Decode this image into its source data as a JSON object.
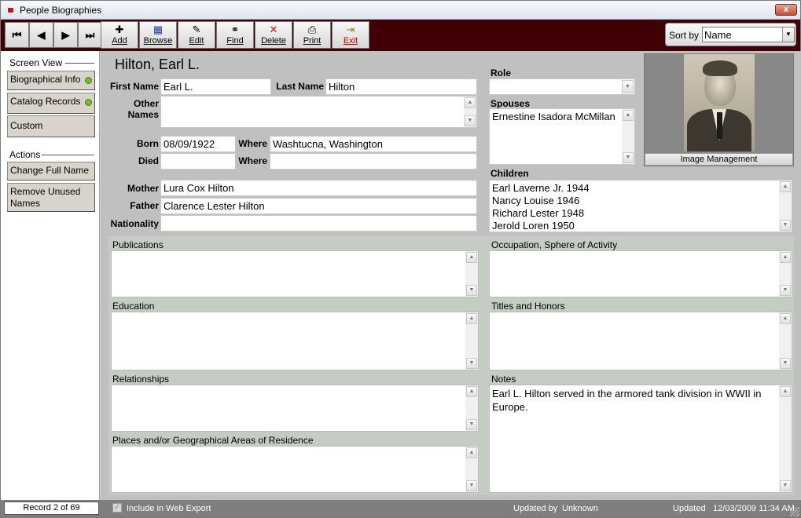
{
  "window": {
    "title": "People Biographies",
    "close_label": "x"
  },
  "toolbar": {
    "nav": {
      "first": "⏮",
      "prev": "◀",
      "next": "▶",
      "last": "⏭"
    },
    "buttons": {
      "add": {
        "label": "Add",
        "icon": "plus-icon"
      },
      "browse": {
        "label": "Browse",
        "icon": "grid-icon"
      },
      "edit": {
        "label": "Edit",
        "icon": "edit-icon"
      },
      "find": {
        "label": "Find",
        "icon": "binoculars-icon"
      },
      "delete": {
        "label": "Delete",
        "icon": "x-icon"
      },
      "print": {
        "label": "Print",
        "icon": "printer-icon"
      },
      "exit": {
        "label": "Exit",
        "icon": "door-exit-icon"
      }
    },
    "sort": {
      "label": "Sort by",
      "value": "Name"
    }
  },
  "sidebar": {
    "screen_view_label": "Screen View",
    "screen_view_items": [
      {
        "label": "Biographical Info",
        "indicator": true
      },
      {
        "label": "Catalog Records",
        "indicator": true
      },
      {
        "label": "Custom",
        "indicator": false
      }
    ],
    "actions_label": "Actions",
    "actions_items": [
      {
        "label": "Change Full Name"
      },
      {
        "label": "Remove Unused Names"
      }
    ]
  },
  "person": {
    "full_name": "Hilton, Earl L.",
    "first_name_label": "First Name",
    "first_name": "Earl L.",
    "last_name_label": "Last Name",
    "last_name": "Hilton",
    "other_names_label": "Other Names",
    "other_names": "",
    "born_label": "Born",
    "born": "08/09/1922",
    "born_where_label": "Where",
    "born_where": "Washtucna, Washington",
    "died_label": "Died",
    "died": "",
    "died_where_label": "Where",
    "died_where": "",
    "mother_label": "Mother",
    "mother": "Lura Cox Hilton",
    "father_label": "Father",
    "father": "Clarence Lester Hilton",
    "nationality_label": "Nationality",
    "nationality": "",
    "role_label": "Role",
    "role": "",
    "spouses_label": "Spouses",
    "spouses": "Ernestine Isadora McMillan",
    "children_label": "Children",
    "children": [
      "Earl Laverne Jr. 1944",
      "Nancy Louise  1946",
      "Richard Lester 1948",
      "Jerold Loren 1950"
    ],
    "image_button": "Image Management"
  },
  "sections": {
    "publications": {
      "label": "Publications",
      "value": ""
    },
    "occupation": {
      "label": "Occupation, Sphere of Activity",
      "value": ""
    },
    "education": {
      "label": "Education",
      "value": ""
    },
    "titles": {
      "label": "Titles and Honors",
      "value": ""
    },
    "relationships": {
      "label": "Relationships",
      "value": ""
    },
    "notes": {
      "label": "Notes",
      "value": "Earl L. Hilton served in the armored tank division in WWII in Europe."
    },
    "places": {
      "label": "Places and/or Geographical Areas of Residence",
      "value": ""
    }
  },
  "status": {
    "record": "Record 2 of 69",
    "web_export_label": "Include in Web Export",
    "web_export_checked": true,
    "updated_by_label": "Updated by",
    "updated_by": "Unknown",
    "updated_label": "Updated",
    "updated": "12/03/2009 11:34 AM"
  }
}
